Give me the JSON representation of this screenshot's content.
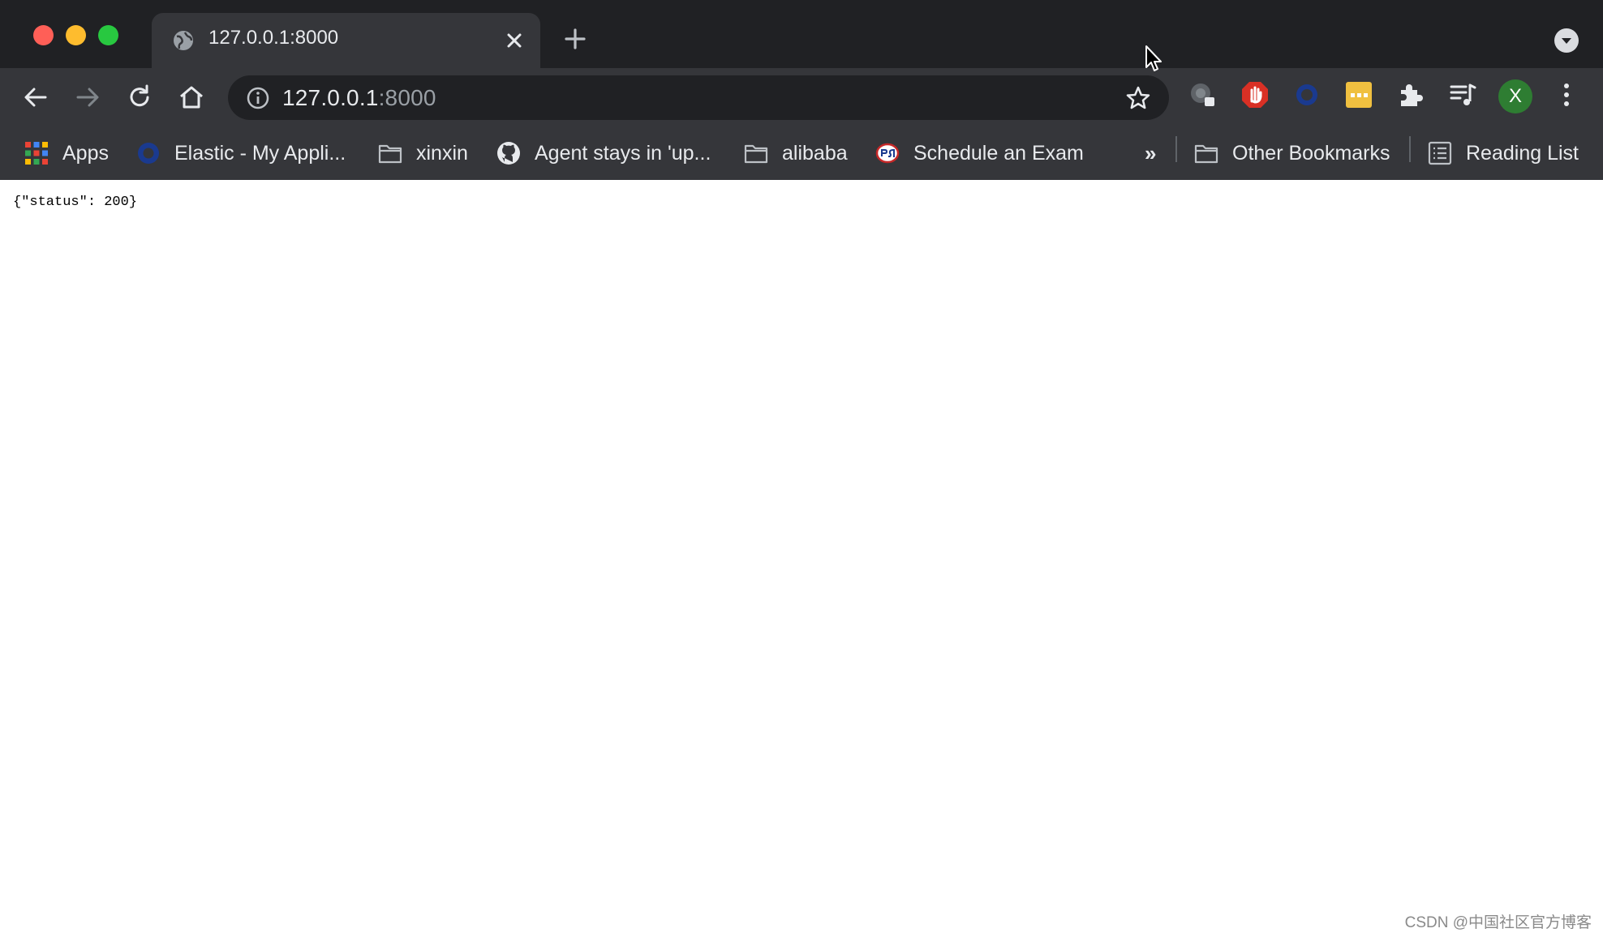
{
  "window": {
    "controls": [
      "close",
      "minimize",
      "zoom"
    ]
  },
  "tab": {
    "title": "127.0.0.1:8000",
    "favicon": "globe-icon",
    "close_icon": "close-icon"
  },
  "toolbar": {
    "back_icon": "arrow-left-icon",
    "forward_icon": "arrow-right-icon",
    "reload_icon": "reload-icon",
    "home_icon": "home-icon",
    "url_host": "127.0.0.1",
    "url_port": ":8000",
    "extensions": [
      "extension-gray-icon",
      "stop-hand-icon",
      "ring-icon",
      "dots-icon",
      "puzzle-icon",
      "media-icon"
    ],
    "profile_initial": "X"
  },
  "bookmarks": {
    "items": [
      {
        "label": "Apps",
        "icon": "apps-grid-icon"
      },
      {
        "label": "Elastic - My Appli...",
        "icon": "ring-icon"
      },
      {
        "label": "xinxin",
        "icon": "folder-icon"
      },
      {
        "label": "Agent stays in 'up...",
        "icon": "github-icon"
      },
      {
        "label": "alibaba",
        "icon": "folder-icon"
      },
      {
        "label": "Schedule an Exam",
        "icon": "psi-icon"
      }
    ],
    "overflow": "»",
    "other": "Other Bookmarks",
    "reading_list": "Reading List"
  },
  "page": {
    "body_text": "{\"status\": 200}"
  },
  "watermark": "CSDN @中国社区官方博客",
  "colors": {
    "chrome_dark": "#202124",
    "toolbar": "#35363a",
    "text_light": "#e8eaed",
    "avatar": "#2e7d32",
    "stop_red": "#d93025",
    "ring_blue": "#1a3a8f",
    "ext_yellow": "#f0c040"
  }
}
